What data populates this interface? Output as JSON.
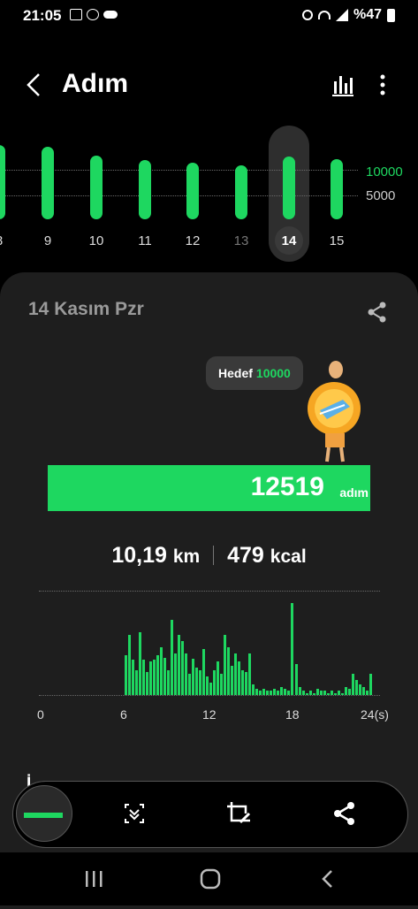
{
  "status": {
    "time": "21:05",
    "battery": "%47"
  },
  "header": {
    "title": "Adım"
  },
  "week": {
    "days": [
      "8",
      "9",
      "10",
      "11",
      "12",
      "13",
      "14",
      "15"
    ],
    "selected": "14",
    "ref_high": "10000",
    "ref_low": "5000",
    "values": [
      10500,
      10300,
      9000,
      8400,
      8000,
      7600,
      8900,
      8500
    ]
  },
  "card": {
    "date": "14 Kasım Pzr",
    "goal_label": "Hedef",
    "goal_value": "10000",
    "steps": "12519",
    "steps_unit": "adım",
    "distance": "10,19",
    "distance_unit": "km",
    "calories": "479",
    "calories_unit": "kcal",
    "partial_heading": "İ"
  },
  "hourly": {
    "ticks": [
      "0",
      "6",
      "12",
      "18",
      "24(s)"
    ],
    "max": 100,
    "values": [
      0,
      0,
      0,
      0,
      0,
      0,
      0,
      0,
      0,
      0,
      0,
      0,
      0,
      0,
      0,
      0,
      0,
      0,
      0,
      0,
      0,
      0,
      0,
      0,
      0,
      0,
      0,
      0,
      0,
      0,
      0,
      0,
      0,
      0,
      0,
      0,
      0,
      0,
      0,
      0,
      0,
      0,
      0,
      0,
      0,
      0,
      0,
      0,
      0,
      0,
      0,
      0,
      0,
      0,
      0,
      0,
      0,
      0,
      0,
      0,
      0,
      0,
      0,
      0,
      0,
      0,
      0,
      0,
      0,
      0,
      0,
      0,
      0,
      0,
      0,
      0,
      0,
      0,
      0,
      0,
      0,
      0,
      0,
      0,
      0,
      0,
      0,
      0,
      0,
      0,
      0,
      0,
      0,
      0,
      0,
      0
    ]
  },
  "colors": {
    "accent": "#1ed760",
    "card": "#1e1e1e"
  }
}
